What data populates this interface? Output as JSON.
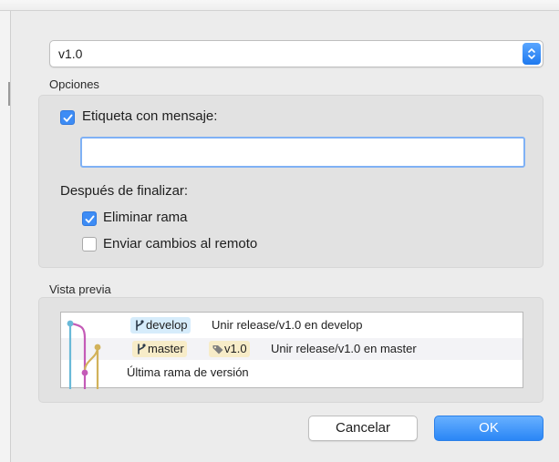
{
  "release": {
    "selected": "v1.0"
  },
  "options": {
    "group_label": "Opciones",
    "tag_with_message": {
      "label": "Etiqueta con mensaje:",
      "checked": true
    },
    "message_value": "",
    "after_finish_label": "Después de finalizar:",
    "delete_branch": {
      "label": "Eliminar rama",
      "checked": true
    },
    "push_changes": {
      "label": "Enviar cambios al remoto",
      "checked": false
    }
  },
  "preview": {
    "group_label": "Vista previa",
    "rows": [
      {
        "branch": "develop",
        "message": "Unir release/v1.0 en develop"
      },
      {
        "branch": "master",
        "tag": "v1.0",
        "message": "Unir release/v1.0 en master"
      },
      {
        "message": "Última rama de versión"
      }
    ]
  },
  "buttons": {
    "cancel": "Cancelar",
    "ok": "OK"
  },
  "icons": {
    "stepper": "up-down-chevron-icon",
    "branch": "branch-icon",
    "tag": "tag-icon",
    "check": "checkmark-icon"
  },
  "colors": {
    "accent": "#3d8cf5",
    "develop_badge": "#d6ecfb",
    "master_badge": "#f7ecc8",
    "graph_blue": "#69b9d8",
    "graph_magenta": "#c45bb7",
    "graph_gold": "#d2b25a"
  }
}
